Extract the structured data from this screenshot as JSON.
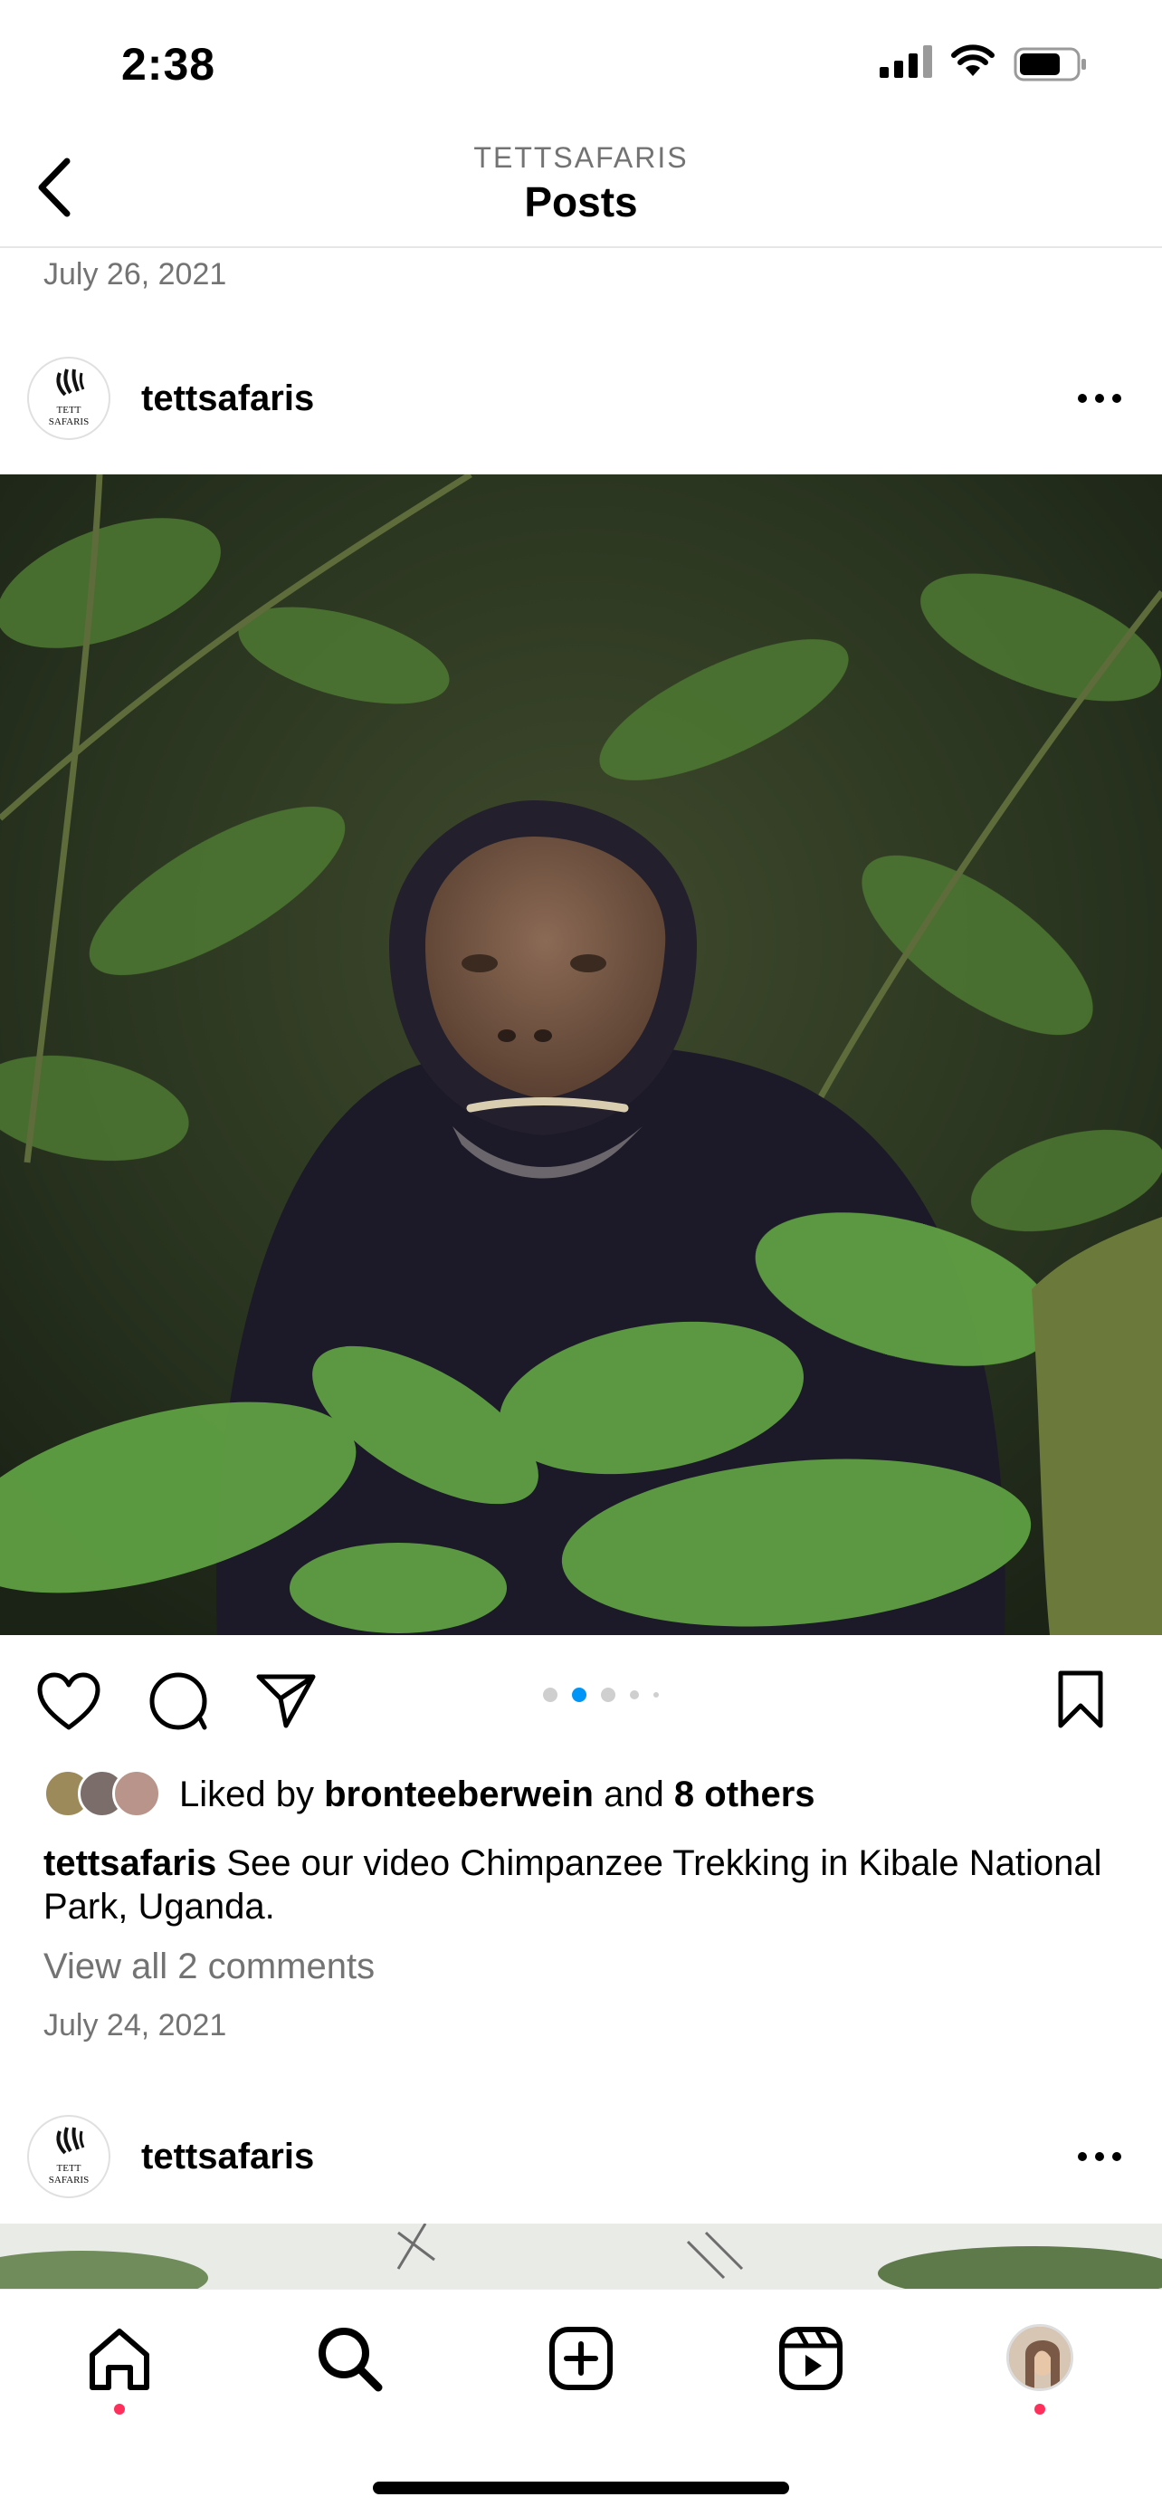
{
  "status_bar": {
    "time": "2:38"
  },
  "header": {
    "account": "TETTSAFARIS",
    "title": "Posts"
  },
  "previous_post": {
    "date": "July 26, 2021"
  },
  "post": {
    "avatar_logo": "TETT SAFARIS",
    "username": "tettsafaris",
    "carousel": {
      "count": 5,
      "active_index": 1
    },
    "likes": {
      "prefix": "Liked by ",
      "liker": "bronteeberwein",
      "connector": " and ",
      "others": "8 others"
    },
    "caption": {
      "username": "tettsafaris",
      "text": " See our video Chimpanzee Trekking in Kibale National Park, Uganda."
    },
    "view_comments": "View all 2 comments",
    "date": "July 24, 2021"
  },
  "next_post": {
    "avatar_logo": "TETT SAFARIS",
    "username": "tettsafaris"
  },
  "tab_bar": {
    "items": [
      "home-icon",
      "search-icon",
      "new-post-icon",
      "reels-icon",
      "profile-avatar"
    ]
  },
  "colors": {
    "accent": "#0095f6",
    "notification": "#ff2f5b",
    "secondary_text": "#737373"
  }
}
